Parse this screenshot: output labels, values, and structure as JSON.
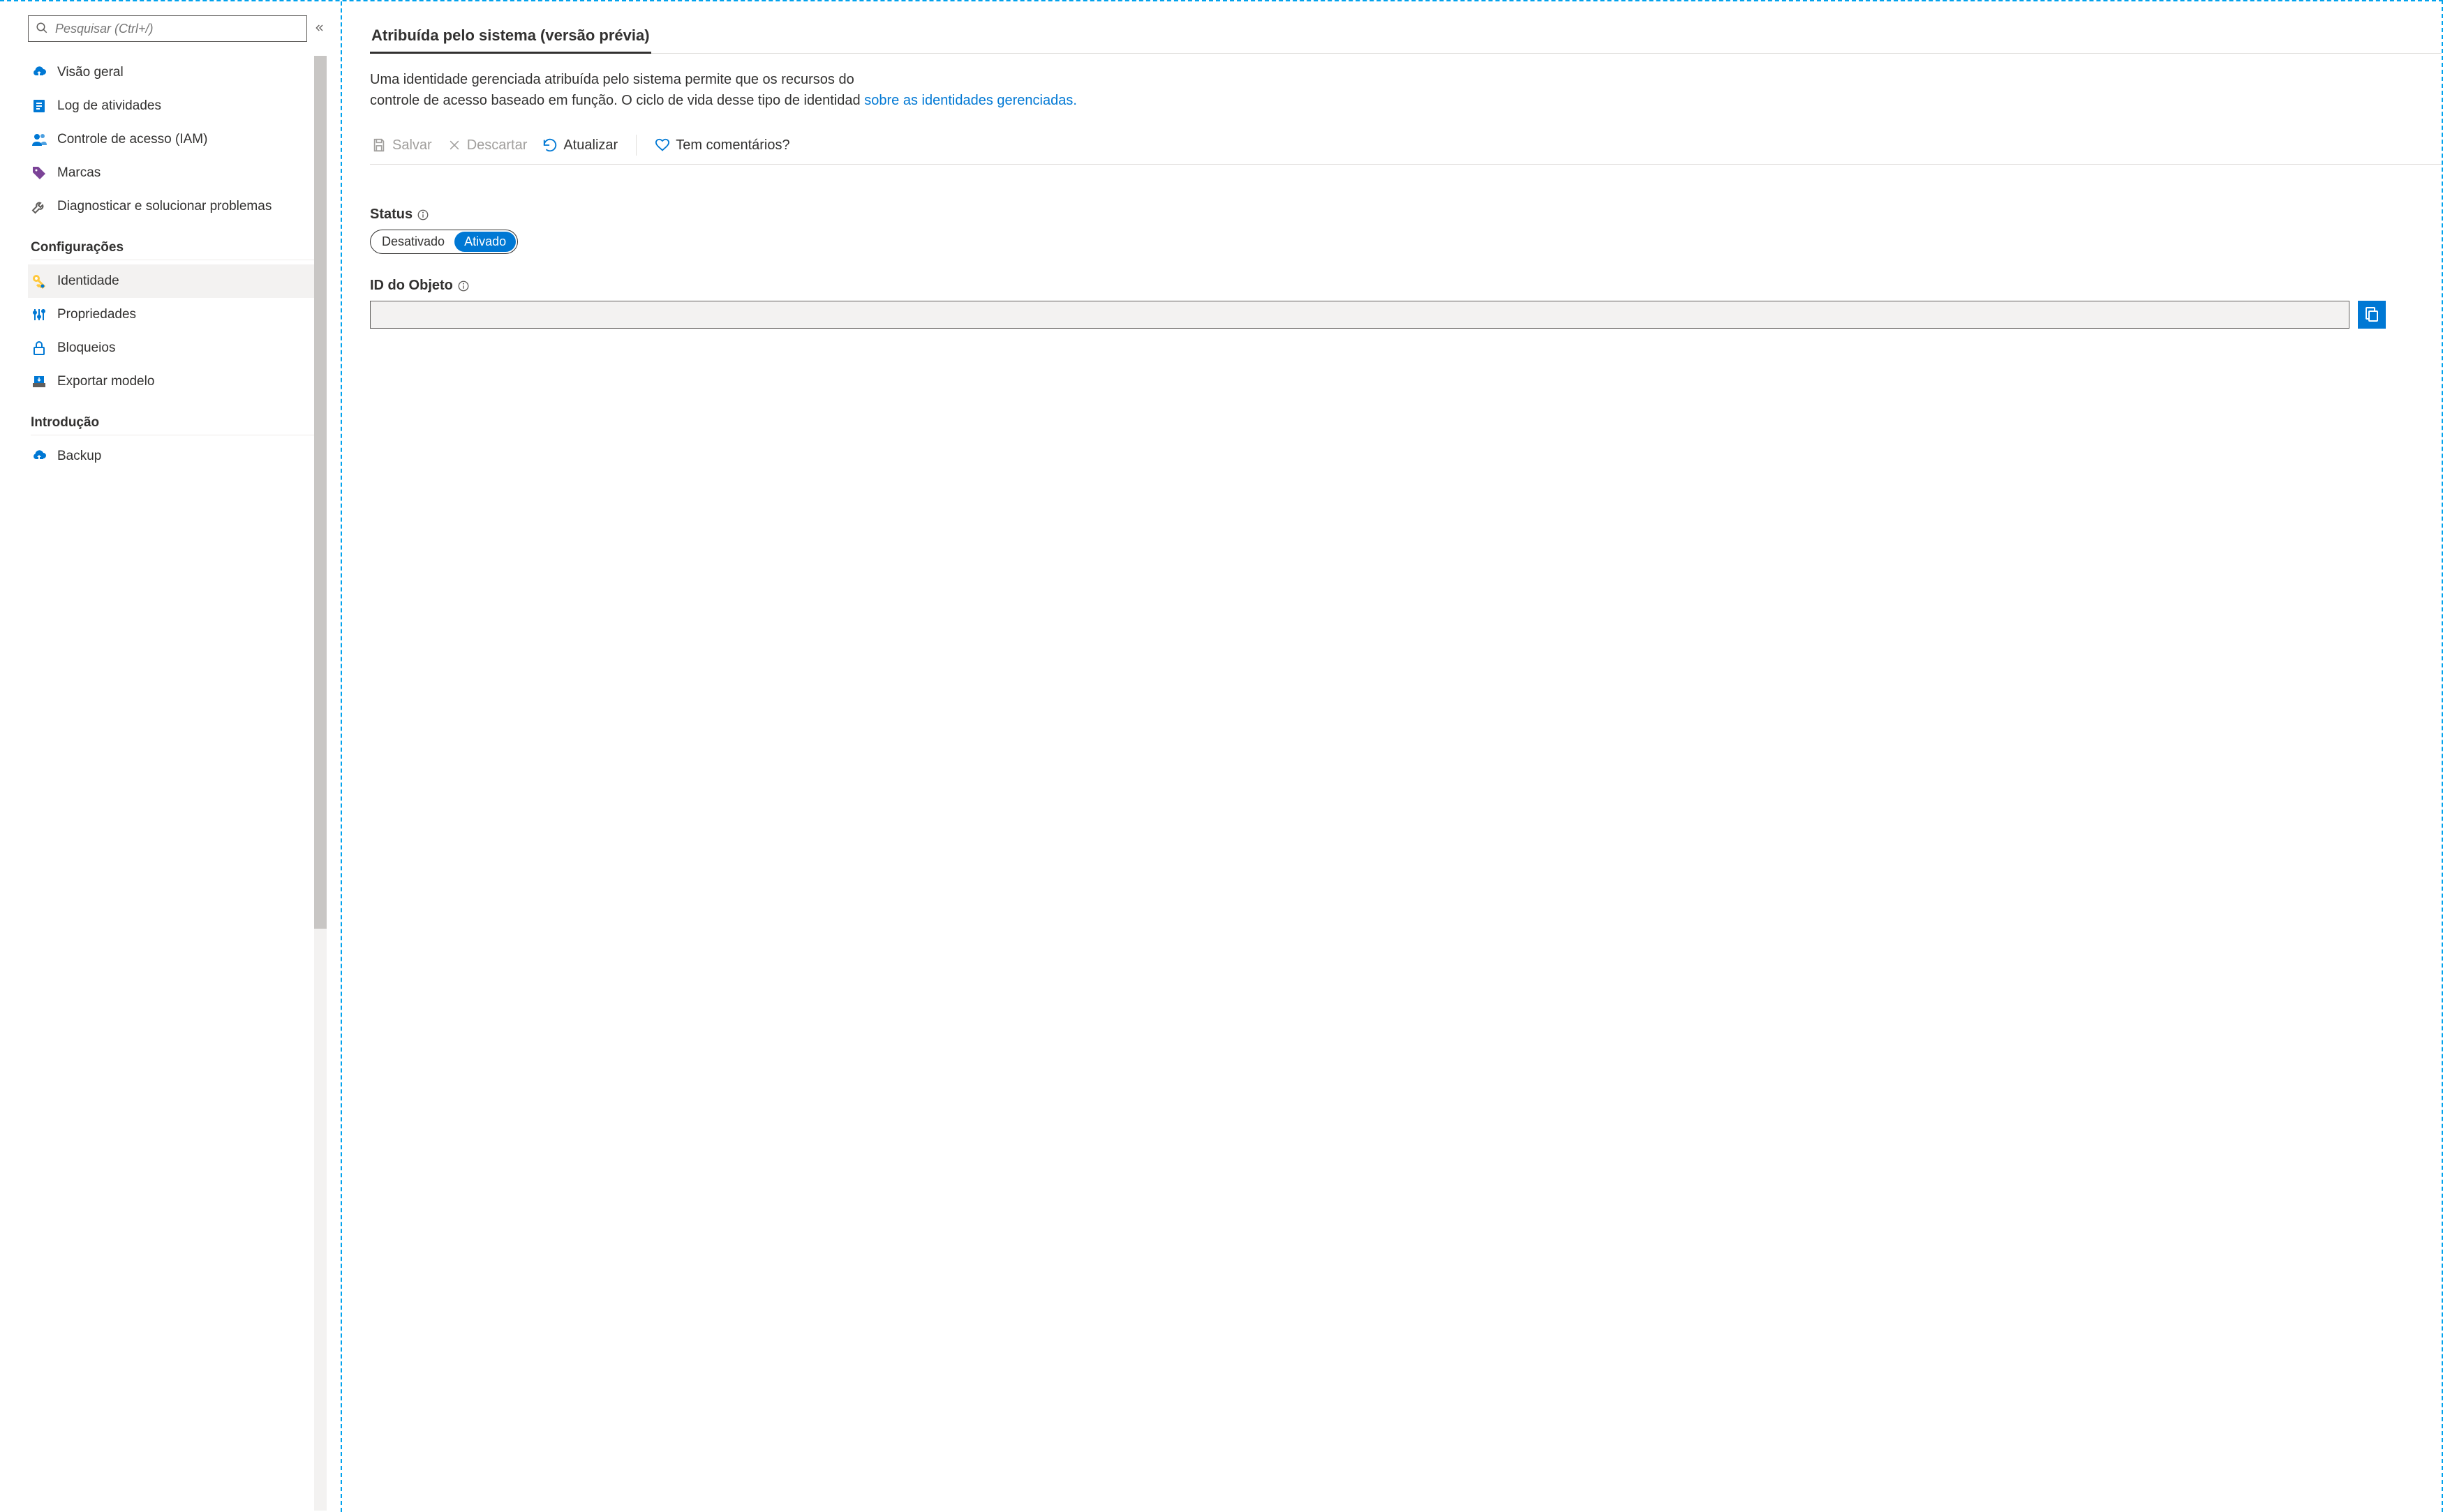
{
  "sidebar": {
    "search_placeholder": "Pesquisar (Ctrl+/)",
    "items_top": [
      {
        "label": "Visão geral",
        "icon": "cloud"
      },
      {
        "label": "Log de atividades",
        "icon": "log"
      },
      {
        "label": "Controle de acesso (IAM)",
        "icon": "people"
      },
      {
        "label": "Marcas",
        "icon": "tag"
      },
      {
        "label": "Diagnosticar e solucionar problemas",
        "icon": "wrench"
      }
    ],
    "section_settings": "Configurações",
    "items_settings": [
      {
        "label": "Identidade",
        "icon": "key",
        "selected": true
      },
      {
        "label": "Propriedades",
        "icon": "sliders"
      },
      {
        "label": "Bloqueios",
        "icon": "lock"
      },
      {
        "label": "Exportar modelo",
        "icon": "export"
      }
    ],
    "section_intro": "Introdução",
    "items_intro": [
      {
        "label": "Backup",
        "icon": "cloud"
      }
    ]
  },
  "main": {
    "tab_label": "Atribuída pelo sistema (versão prévia)",
    "description_line1": "Uma identidade gerenciada atribuída pelo sistema permite que os recursos do",
    "description_line2": "controle de acesso baseado em função. O ciclo de vida desse tipo de identidad",
    "description_link": "sobre as identidades gerenciadas.",
    "toolbar": {
      "save": "Salvar",
      "discard": "Descartar",
      "refresh": "Atualizar",
      "feedback": "Tem comentários?"
    },
    "status_label": "Status",
    "toggle": {
      "off": "Desativado",
      "on": "Ativado"
    },
    "object_id_label": "ID do Objeto",
    "object_id_value": ""
  }
}
